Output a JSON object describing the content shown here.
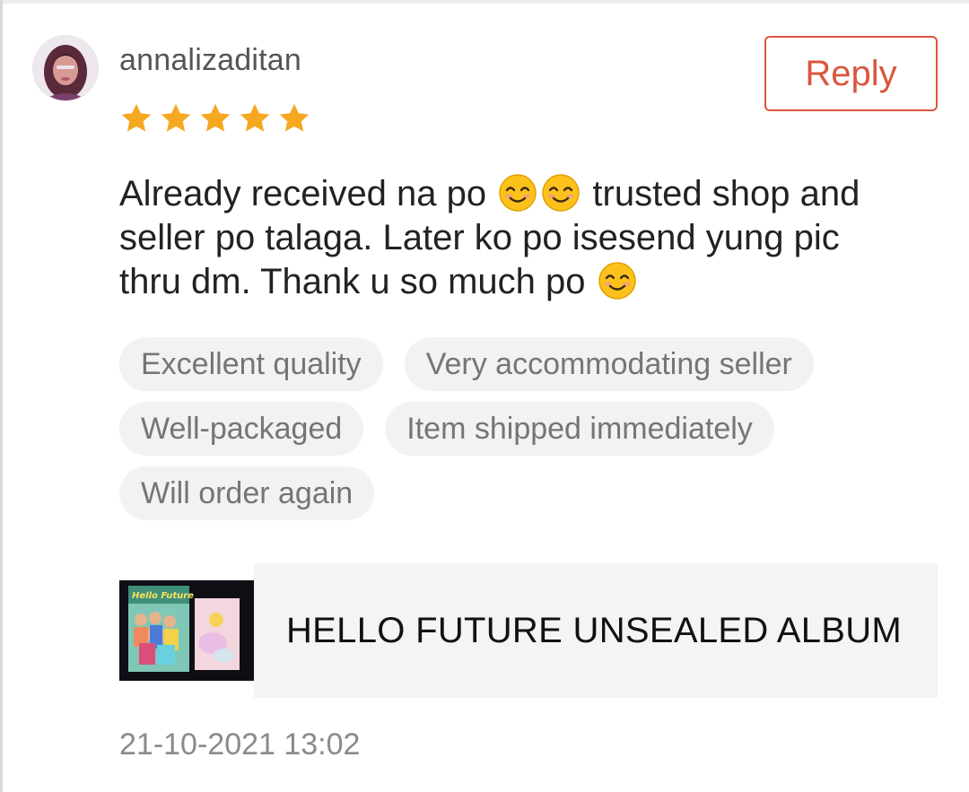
{
  "review": {
    "username": "annalizaditan",
    "rating": 5,
    "reply_label": "Reply",
    "text": {
      "line1_a": "Already received na po",
      "line1_b": "trusted shop and",
      "line2": "seller po talaga. Later ko po isesend yung pic",
      "line3": "thru dm. Thank u so much po"
    },
    "tags": [
      "Excellent quality",
      "Very accommodating seller",
      "Well-packaged",
      "Item shipped immediately",
      "Will order again"
    ],
    "product": {
      "name": "HELLO FUTURE UNSEALED ALBUM",
      "thumbnail_text": "Hello Future"
    },
    "timestamp": "21-10-2021 13:02"
  },
  "colors": {
    "accent": "#d9573d",
    "star": "#f6a821",
    "tag_bg": "#f2f2f2",
    "product_bg": "#f4f4f4"
  },
  "icons": {
    "star": "star-icon",
    "emoji": "smiling-face-icon"
  }
}
